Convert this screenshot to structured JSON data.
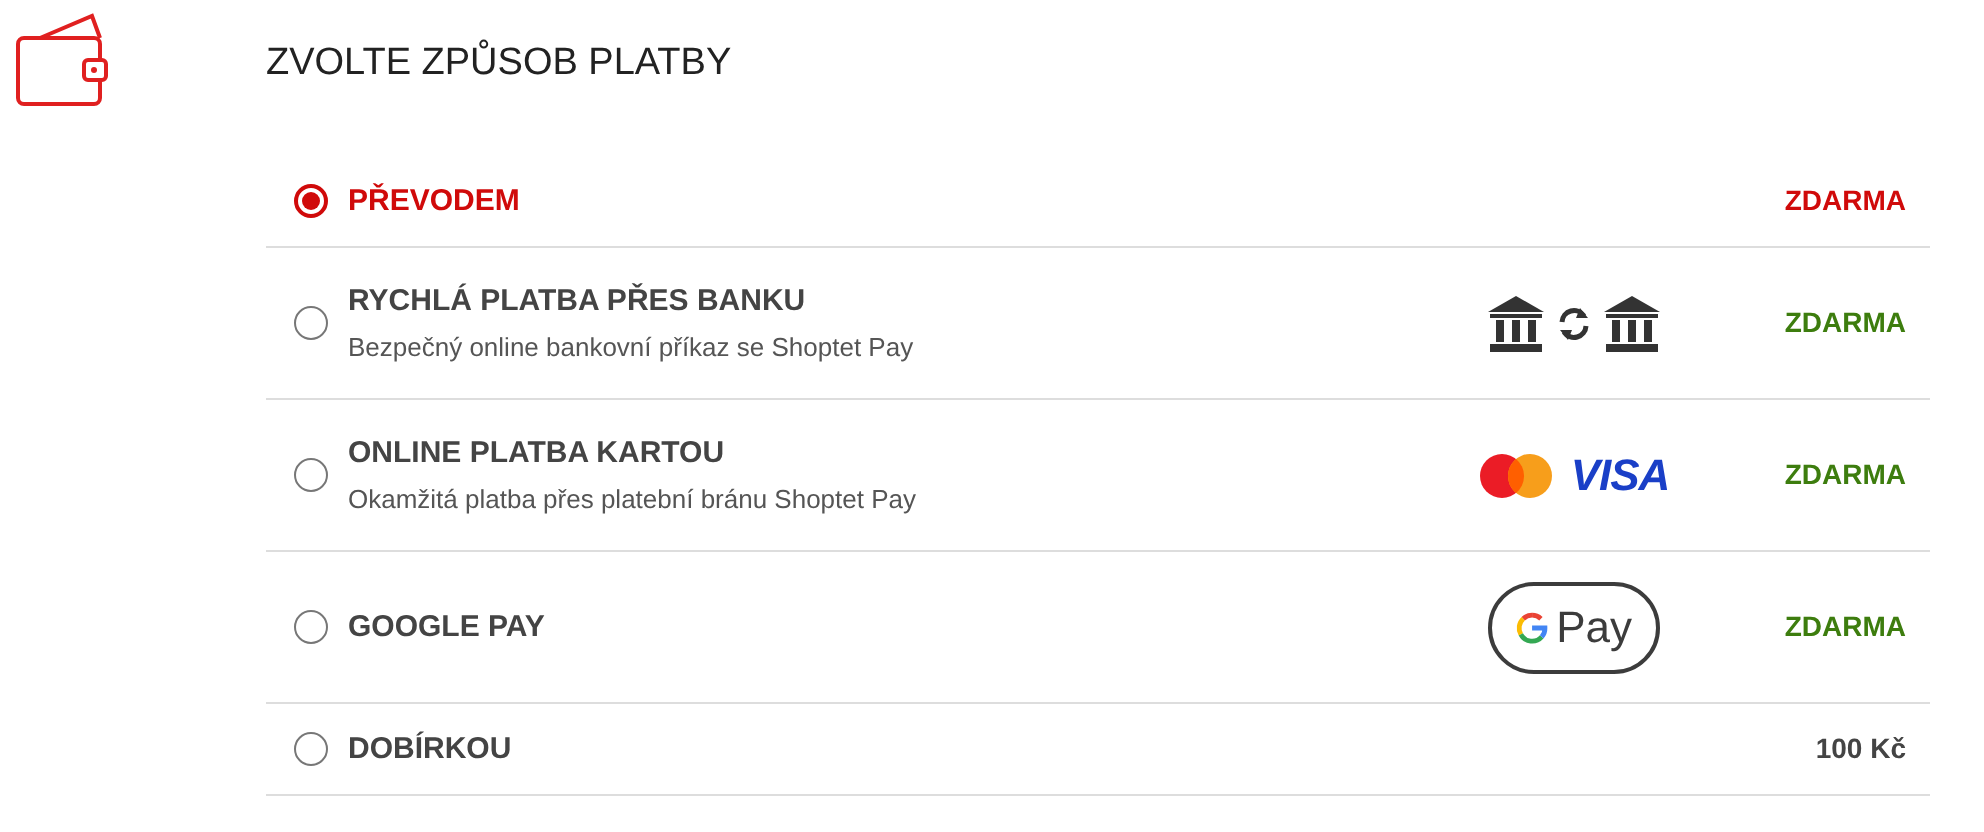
{
  "title": "ZVOLTE ZPŮSOB PLATBY",
  "methods": [
    {
      "name": "PŘEVODEM",
      "selected": true,
      "price": {
        "text": "ZDARMA",
        "color": "#d00a0a"
      }
    },
    {
      "name": "RYCHLÁ PLATBA PŘES BANKU",
      "description": "Bezpečný online bankovní příkaz se Shoptet Pay",
      "selected": false,
      "logo": {
        "kind": "bank"
      },
      "price": {
        "text": "ZDARMA",
        "color": "#3d7d0e"
      }
    },
    {
      "name": "ONLINE PLATBA KARTOU",
      "description": "Okamžitá platba přes platební bránu Shoptet Pay",
      "selected": false,
      "logo": {
        "kind": "cards",
        "text": "VISA"
      },
      "price": {
        "text": "ZDARMA",
        "color": "#3d7d0e"
      }
    },
    {
      "name": "GOOGLE PAY",
      "selected": false,
      "logo": {
        "kind": "gpay",
        "text": "Pay"
      },
      "price": {
        "text": "ZDARMA",
        "color": "#3d7d0e"
      }
    },
    {
      "name": "DOBÍRKOU",
      "selected": false,
      "price": {
        "text": "100 Kč",
        "color": "#444444"
      }
    }
  ]
}
